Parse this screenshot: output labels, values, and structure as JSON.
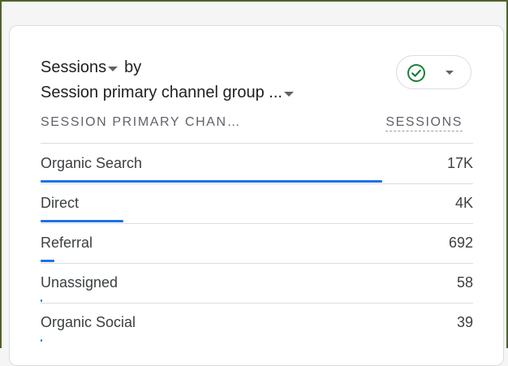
{
  "card": {
    "metric_label": "Sessions",
    "by_label": "by",
    "dimension_label": "Session primary channel group ...",
    "status_icon": "check-circle-icon",
    "status_color": "#188038",
    "accent_color": "#1a73e8"
  },
  "table": {
    "col_dimension": "SESSION PRIMARY CHAN…",
    "col_metric": "SESSIONS",
    "rows": [
      {
        "label": "Organic Search",
        "value": "17K",
        "share": 1.0
      },
      {
        "label": "Direct",
        "value": "4K",
        "share": 0.243
      },
      {
        "label": "Referral",
        "value": "692",
        "share": 0.041
      },
      {
        "label": "Unassigned",
        "value": "58",
        "share": 0.004
      },
      {
        "label": "Organic Social",
        "value": "39",
        "share": 0.003
      }
    ]
  }
}
